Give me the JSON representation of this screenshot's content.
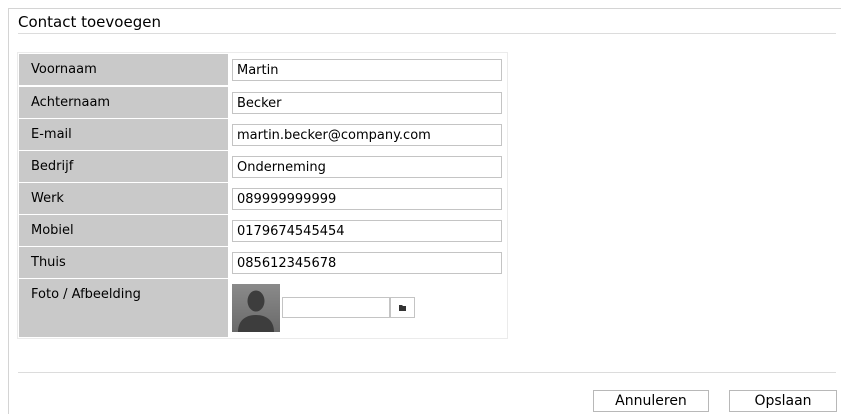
{
  "dialog": {
    "title": "Contact toevoegen"
  },
  "form": {
    "fields": [
      {
        "label": "Voornaam",
        "value": "Martin"
      },
      {
        "label": "Achternaam",
        "value": "Becker"
      },
      {
        "label": "E-mail",
        "value": "martin.becker@company.com"
      },
      {
        "label": "Bedrijf",
        "value": "Onderneming"
      },
      {
        "label": "Werk",
        "value": "089999999999"
      },
      {
        "label": "Mobiel",
        "value": "0179674545454"
      },
      {
        "label": "Thuis",
        "value": "085612345678"
      }
    ],
    "photo": {
      "label": "Foto / Afbeelding",
      "file_value": "",
      "avatar_icon": "person-silhouette-icon",
      "browse_icon": "folder-icon"
    }
  },
  "buttons": {
    "cancel": "Annuleren",
    "save": "Opslaan"
  },
  "colors": {
    "label_bg": "#c9c9c9",
    "avatar_bg": "#7a7a7a"
  }
}
